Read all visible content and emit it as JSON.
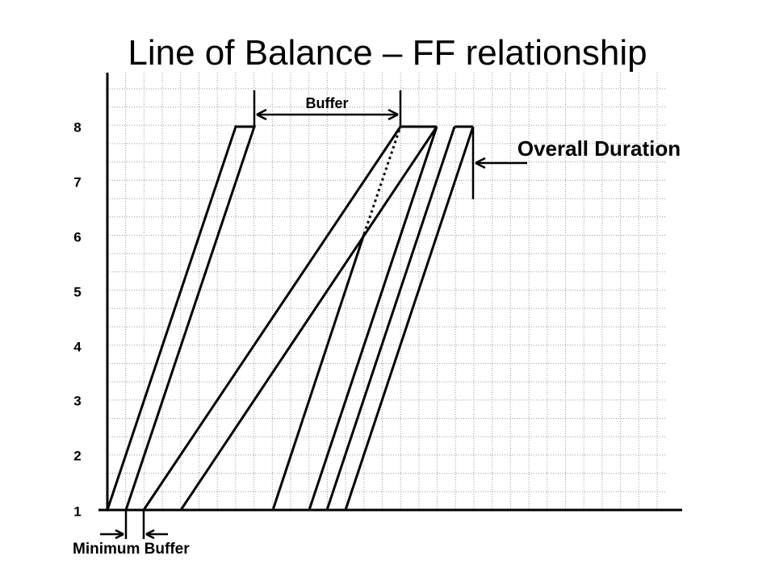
{
  "title": "Line of Balance – FF relationship",
  "y_ticks": [
    "1",
    "2",
    "3",
    "4",
    "5",
    "6",
    "7",
    "8"
  ],
  "annotations": {
    "buffer": "Buffer",
    "overall_duration": "Overall Duration",
    "minimum_buffer": "Minimum Buffer"
  },
  "colors": {
    "line": "#000000",
    "grid": "#9a9a9a",
    "background": "#ffffff"
  }
}
